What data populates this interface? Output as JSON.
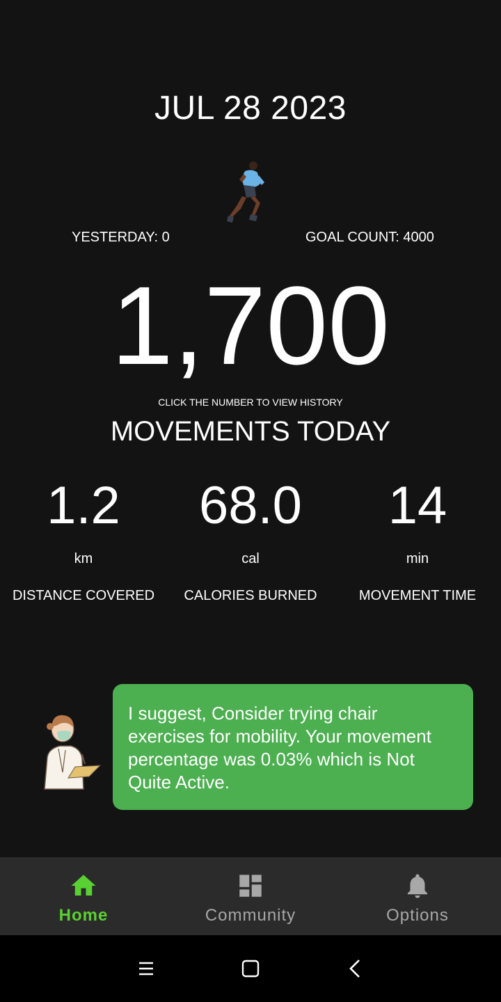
{
  "date": "JUL 28 2023",
  "yesterday": "YESTERDAY: 0",
  "goal_count": "GOAL COUNT: 4000",
  "count": "1,700",
  "hint": "CLICK THE NUMBER TO VIEW HISTORY",
  "movements_label": "MOVEMENTS TODAY",
  "metrics": [
    {
      "value": "1.2",
      "unit": "km",
      "label": "DISTANCE COVERED"
    },
    {
      "value": "68.0",
      "unit": "cal",
      "label": "CALORIES BURNED"
    },
    {
      "value": "14",
      "unit": "min",
      "label": "MOVEMENT TIME"
    }
  ],
  "suggestion": "I suggest, Consider trying chair exercises for mobility. Your movement percentage was 0.03% which is Not Quite Active.",
  "nav": {
    "home": "Home",
    "community": "Community",
    "options": "Options"
  },
  "colors": {
    "background": "#131313",
    "bubble": "#4caf50",
    "active_nav": "#5ad132",
    "inactive_nav": "#a8a8a8",
    "navbar": "#2b2b2b"
  },
  "icons": [
    "runner-illustration",
    "doctor-illustration",
    "home-icon",
    "dashboard-icon",
    "bell-icon",
    "menu-icon",
    "square-home-icon",
    "back-chevron-icon"
  ]
}
